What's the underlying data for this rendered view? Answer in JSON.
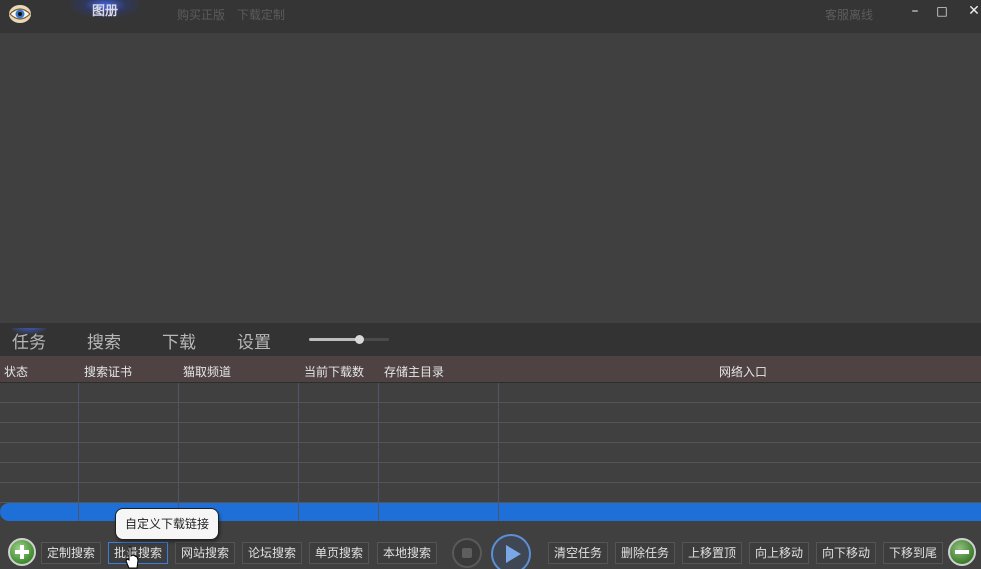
{
  "titlebar": {
    "tab_album": "图册",
    "link_buy": "购买正版",
    "link_custom": "下载定制",
    "cs_status": "客服离线",
    "minimize": "–",
    "maximize": "□",
    "close": "✕"
  },
  "tabs": [
    "任务",
    "搜索",
    "下载",
    "设置"
  ],
  "zoom": {
    "level": 0.62
  },
  "table": {
    "columns": [
      "状态",
      "搜索证书",
      "猫取频道",
      "当前下载数",
      "存储主目录",
      "网络入口"
    ],
    "rows": [
      [
        "",
        "",
        "",
        "",
        "",
        ""
      ],
      [
        "",
        "",
        "",
        "",
        "",
        ""
      ],
      [
        "",
        "",
        "",
        "",
        "",
        ""
      ],
      [
        "",
        "",
        "",
        "",
        "",
        ""
      ],
      [
        "",
        "",
        "",
        "",
        "",
        ""
      ],
      [
        "",
        "",
        "",
        "",
        "",
        ""
      ],
      [
        "",
        "",
        "",
        "",
        "",
        ""
      ]
    ]
  },
  "toolbar": {
    "search_buttons": [
      "定制搜索",
      "批量搜索",
      "网站搜索",
      "论坛搜索",
      "单页搜索",
      "本地搜索"
    ],
    "task_buttons": [
      "清空任务",
      "删除任务",
      "上移置顶",
      "向上移动",
      "向下移动",
      "下移到尾"
    ]
  },
  "tooltip": "自定义下载链接",
  "colors": {
    "accent": "#1e6fd8",
    "background": "#404040",
    "titlebar": "#353535",
    "header": "#4e4342"
  }
}
